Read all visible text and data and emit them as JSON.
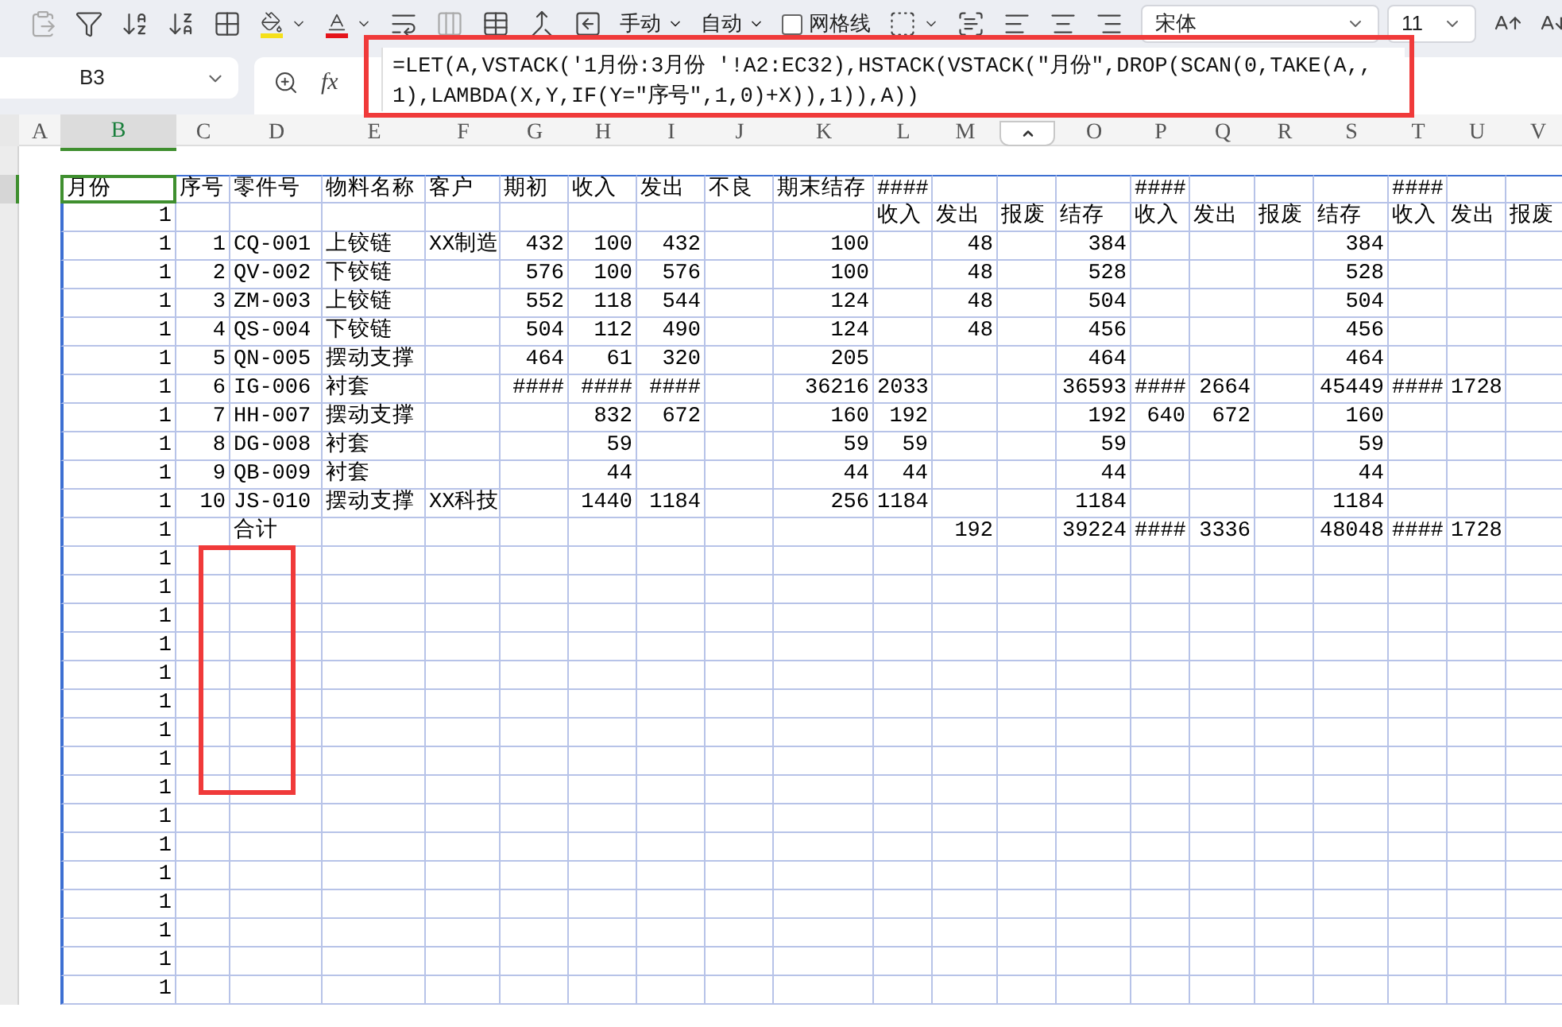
{
  "toolbar": {
    "calc_mode": "手动",
    "auto_label": "自动",
    "gridlines": {
      "label": "网格线",
      "checked": false
    },
    "font": "宋体",
    "font_size": "11"
  },
  "formula_bar": {
    "name_box": "B3",
    "fx": "fx",
    "formula": "=LET(A,VSTACK('1月份:3月份 '!A2:EC32),HSTACK(VSTACK(\"月份\",DROP(SCAN(0,TAKE(A,,1),LAMBDA(X,Y,IF(Y=\"序号\",1,0)+X)),1)),A))"
  },
  "columns": [
    {
      "label": "A",
      "selected": false
    },
    {
      "label": "B",
      "selected": true
    },
    {
      "label": "C",
      "selected": false
    },
    {
      "label": "D",
      "selected": false
    },
    {
      "label": "E",
      "selected": false
    },
    {
      "label": "F",
      "selected": false
    },
    {
      "label": "G",
      "selected": false
    },
    {
      "label": "H",
      "selected": false
    },
    {
      "label": "I",
      "selected": false
    },
    {
      "label": "J",
      "selected": false
    },
    {
      "label": "K",
      "selected": false
    },
    {
      "label": "L",
      "selected": false
    },
    {
      "label": "M",
      "selected": false
    },
    {
      "selected": false
    },
    {
      "label": "O",
      "selected": false
    },
    {
      "label": "P",
      "selected": false
    },
    {
      "label": "Q",
      "selected": false
    },
    {
      "label": "R",
      "selected": false
    },
    {
      "label": "S",
      "selected": false
    },
    {
      "label": "T",
      "selected": false
    },
    {
      "label": "U",
      "selected": false
    },
    {
      "label": "V",
      "selected": false
    }
  ],
  "rows": [
    {
      "selected": true,
      "texts": {
        "B": "月份",
        "C": "序号",
        "D": "零件号",
        "E": "物料名称",
        "F": "客户",
        "G": "期初",
        "H": "收入",
        "I": "发出",
        "J": "不良",
        "K": "期末结存",
        "L": "####",
        "P": "####",
        "T": "####"
      }
    },
    {
      "selected": false,
      "numbers": {
        "B": "1"
      },
      "texts": {
        "L": "收入",
        "M": "发出",
        "N": "报废",
        "O": "结存",
        "P": "收入",
        "Q": "发出",
        "R": "报废",
        "S": "结存",
        "T": "收入",
        "U": "发出",
        "V": "报废"
      }
    },
    {
      "selected": false,
      "numbers": {
        "B": "1",
        "C": "1",
        "G": "432",
        "H": "100",
        "I": "432",
        "K": "100",
        "M": "48",
        "O": "384",
        "S": "384"
      },
      "texts": {
        "D": "CQ-001",
        "E": "上铰链",
        "F": "XX制造"
      }
    },
    {
      "selected": false,
      "numbers": {
        "B": "1",
        "C": "2",
        "G": "576",
        "H": "100",
        "I": "576",
        "K": "100",
        "M": "48",
        "O": "528",
        "S": "528"
      },
      "texts": {
        "D": "QV-002",
        "E": "下铰链"
      }
    },
    {
      "selected": false,
      "numbers": {
        "B": "1",
        "C": "3",
        "G": "552",
        "H": "118",
        "I": "544",
        "K": "124",
        "M": "48",
        "O": "504",
        "S": "504"
      },
      "texts": {
        "D": "ZM-003",
        "E": "上铰链"
      }
    },
    {
      "selected": false,
      "numbers": {
        "B": "1",
        "C": "4",
        "G": "504",
        "H": "112",
        "I": "490",
        "K": "124",
        "M": "48",
        "O": "456",
        "S": "456"
      },
      "texts": {
        "D": "QS-004",
        "E": "下铰链"
      }
    },
    {
      "selected": false,
      "numbers": {
        "B": "1",
        "C": "5",
        "G": "464",
        "H": "61",
        "I": "320",
        "K": "205",
        "O": "464",
        "S": "464"
      },
      "texts": {
        "D": "QN-005",
        "E": "摆动支撑"
      }
    },
    {
      "selected": false,
      "numbers": {
        "B": "1",
        "C": "6",
        "G": "####",
        "H": "####",
        "I": "####",
        "K": "36216",
        "L": "2033",
        "O": "36593",
        "P": "####",
        "Q": "2664",
        "S": "45449",
        "T": "####",
        "U": "1728"
      },
      "texts": {
        "D": "IG-006",
        "E": "衬套"
      }
    },
    {
      "selected": false,
      "numbers": {
        "B": "1",
        "C": "7",
        "H": "832",
        "I": "672",
        "K": "160",
        "L": "192",
        "O": "192",
        "P": "640",
        "Q": "672",
        "S": "160"
      },
      "texts": {
        "D": "HH-007",
        "E": "摆动支撑"
      }
    },
    {
      "selected": false,
      "numbers": {
        "B": "1",
        "C": "8",
        "H": "59",
        "K": "59",
        "L": "59",
        "O": "59",
        "S": "59"
      },
      "texts": {
        "D": "DG-008",
        "E": "衬套"
      }
    },
    {
      "selected": false,
      "numbers": {
        "B": "1",
        "C": "9",
        "H": "44",
        "K": "44",
        "L": "44",
        "O": "44",
        "S": "44"
      },
      "texts": {
        "D": "QB-009",
        "E": "衬套"
      }
    },
    {
      "selected": false,
      "numbers": {
        "B": "1",
        "C": "10",
        "H": "1440",
        "I": "1184",
        "K": "256",
        "L": "1184",
        "O": "1184",
        "S": "1184"
      },
      "texts": {
        "D": "JS-010",
        "E": "摆动支撑",
        "F": "XX科技"
      }
    },
    {
      "selected": false,
      "numbers": {
        "B": "1",
        "M": "192",
        "O": "39224",
        "P": "####",
        "Q": "3336",
        "S": "48048",
        "T": "####",
        "U": "1728"
      },
      "texts": {
        "D": "合计"
      }
    },
    {
      "selected": false,
      "numbers": {
        "B": "1"
      }
    },
    {
      "selected": false,
      "numbers": {
        "B": "1"
      }
    },
    {
      "selected": false,
      "numbers": {
        "B": "1"
      }
    },
    {
      "selected": false,
      "numbers": {
        "B": "1"
      }
    },
    {
      "selected": false,
      "numbers": {
        "B": "1"
      }
    },
    {
      "selected": false,
      "numbers": {
        "B": "1"
      }
    },
    {
      "selected": false,
      "numbers": {
        "B": "1"
      }
    },
    {
      "selected": false,
      "numbers": {
        "B": "1"
      }
    },
    {
      "selected": false,
      "numbers": {
        "B": "1"
      }
    },
    {
      "selected": false,
      "numbers": {
        "B": "1"
      }
    },
    {
      "selected": false,
      "numbers": {
        "B": "1"
      }
    },
    {
      "selected": false,
      "numbers": {
        "B": "1"
      }
    },
    {
      "selected": false,
      "numbers": {
        "B": "1"
      }
    },
    {
      "selected": false,
      "numbers": {
        "B": "1"
      }
    },
    {
      "selected": false,
      "numbers": {
        "B": "1"
      }
    },
    {
      "selected": false,
      "numbers": {
        "B": "1"
      }
    }
  ]
}
